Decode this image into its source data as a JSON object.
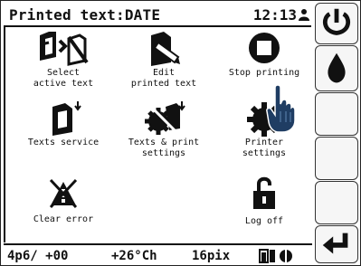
{
  "header": {
    "title": "Printed text:DATE",
    "time": "12:13"
  },
  "tiles": [
    {
      "label": "Select\nactive text",
      "icon": "select-active-text-icon"
    },
    {
      "label": "Edit\nprinted text",
      "icon": "edit-printed-text-icon"
    },
    {
      "label": "Stop printing",
      "icon": "stop-printing-icon"
    },
    {
      "label": "Texts service",
      "icon": "texts-service-icon"
    },
    {
      "label": "Texts & print\nsettings",
      "icon": "texts-print-settings-icon"
    },
    {
      "label": "Printer\nsettings",
      "icon": "printer-settings-icon"
    },
    {
      "label": "Clear error",
      "icon": "clear-error-icon"
    },
    {
      "label": "Log off",
      "icon": "log-off-icon"
    }
  ],
  "sidebar": {
    "buttons": [
      "power-icon",
      "ink-drop-icon",
      "empty",
      "empty",
      "empty",
      "return-arrow-icon"
    ]
  },
  "status": {
    "format": "4p6/ +00",
    "temperature": "+26°Ch",
    "resolution": "16pix"
  },
  "colors": {
    "ink": "#111111",
    "background": "#ffffff",
    "hand": "#1f3d63"
  }
}
